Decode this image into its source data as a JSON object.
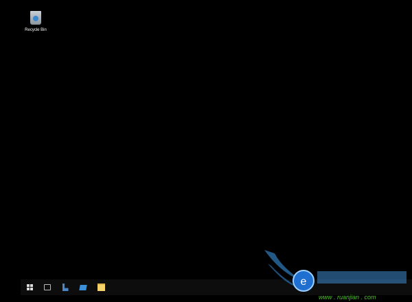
{
  "desktop": {
    "icons": [
      {
        "label": "Recycle Bin",
        "icon": "recycle-bin-icon"
      }
    ]
  },
  "taskbar": {
    "items": [
      {
        "name": "start",
        "icon": "windows-logo-icon"
      },
      {
        "name": "task-view",
        "icon": "task-view-icon"
      },
      {
        "name": "powershell",
        "icon": "powershell-icon"
      },
      {
        "name": "internet-explorer",
        "icon": "internet-explorer-icon"
      },
      {
        "name": "file-explorer",
        "icon": "folder-icon"
      }
    ]
  },
  "watermark": {
    "text": "www.ruanjian.com"
  }
}
